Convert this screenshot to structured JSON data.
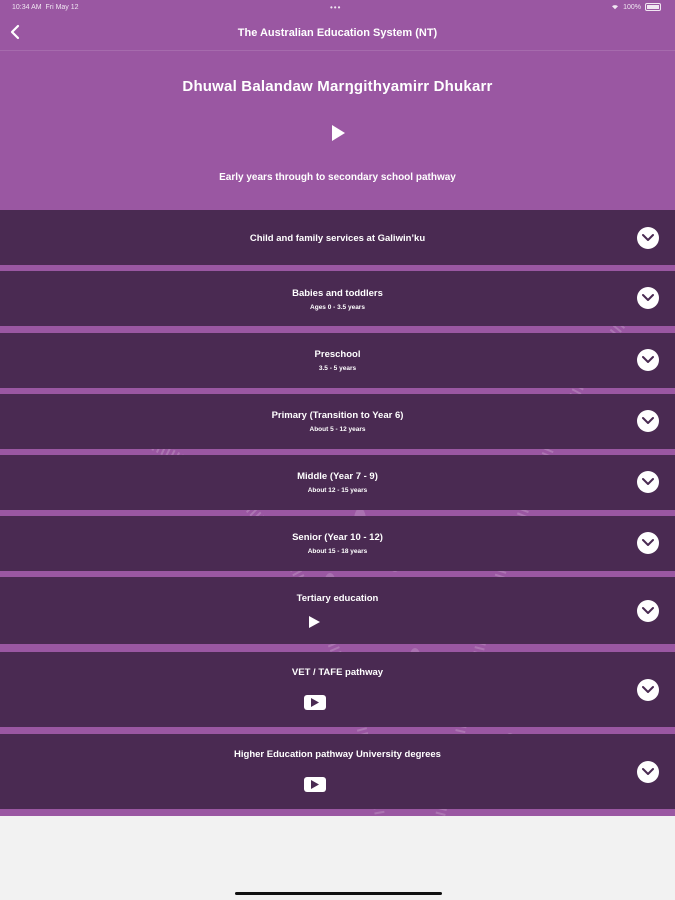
{
  "status": {
    "time": "10:34 AM",
    "date": "Fri May 12",
    "battery": "100%"
  },
  "nav": {
    "title": "The Australian Education System (NT)"
  },
  "header": {
    "title": "Dhuwal Balandaw Marŋgithyamirr Dhukarr",
    "subtitle": "Early years through to secondary school pathway"
  },
  "sections": [
    {
      "title": "Child and family services at Galiwin’ku"
    },
    {
      "title": "Babies and toddlers",
      "sub": "Ages 0 - 3.5 years"
    },
    {
      "title": "Preschool",
      "sub": "3.5 - 5 years"
    },
    {
      "title": "Primary (Transition to Year 6)",
      "sub": "About 5 - 12 years"
    },
    {
      "title": "Middle (Year 7 - 9)",
      "sub": "About 12 - 15 years"
    },
    {
      "title": "Senior (Year 10 - 12)",
      "sub": "About 15 - 18 years"
    },
    {
      "title": "Tertiary education"
    },
    {
      "title": "VET / TAFE pathway"
    },
    {
      "title": "Higher Education pathway University degrees"
    }
  ],
  "icons": {
    "back": "chevron-left-icon",
    "play": "play-icon",
    "expand": "chevron-down-icon",
    "video": "youtube-play-icon"
  },
  "colors": {
    "background": "#9a57a2",
    "section": "#4a2a52",
    "text": "#ffffff"
  }
}
